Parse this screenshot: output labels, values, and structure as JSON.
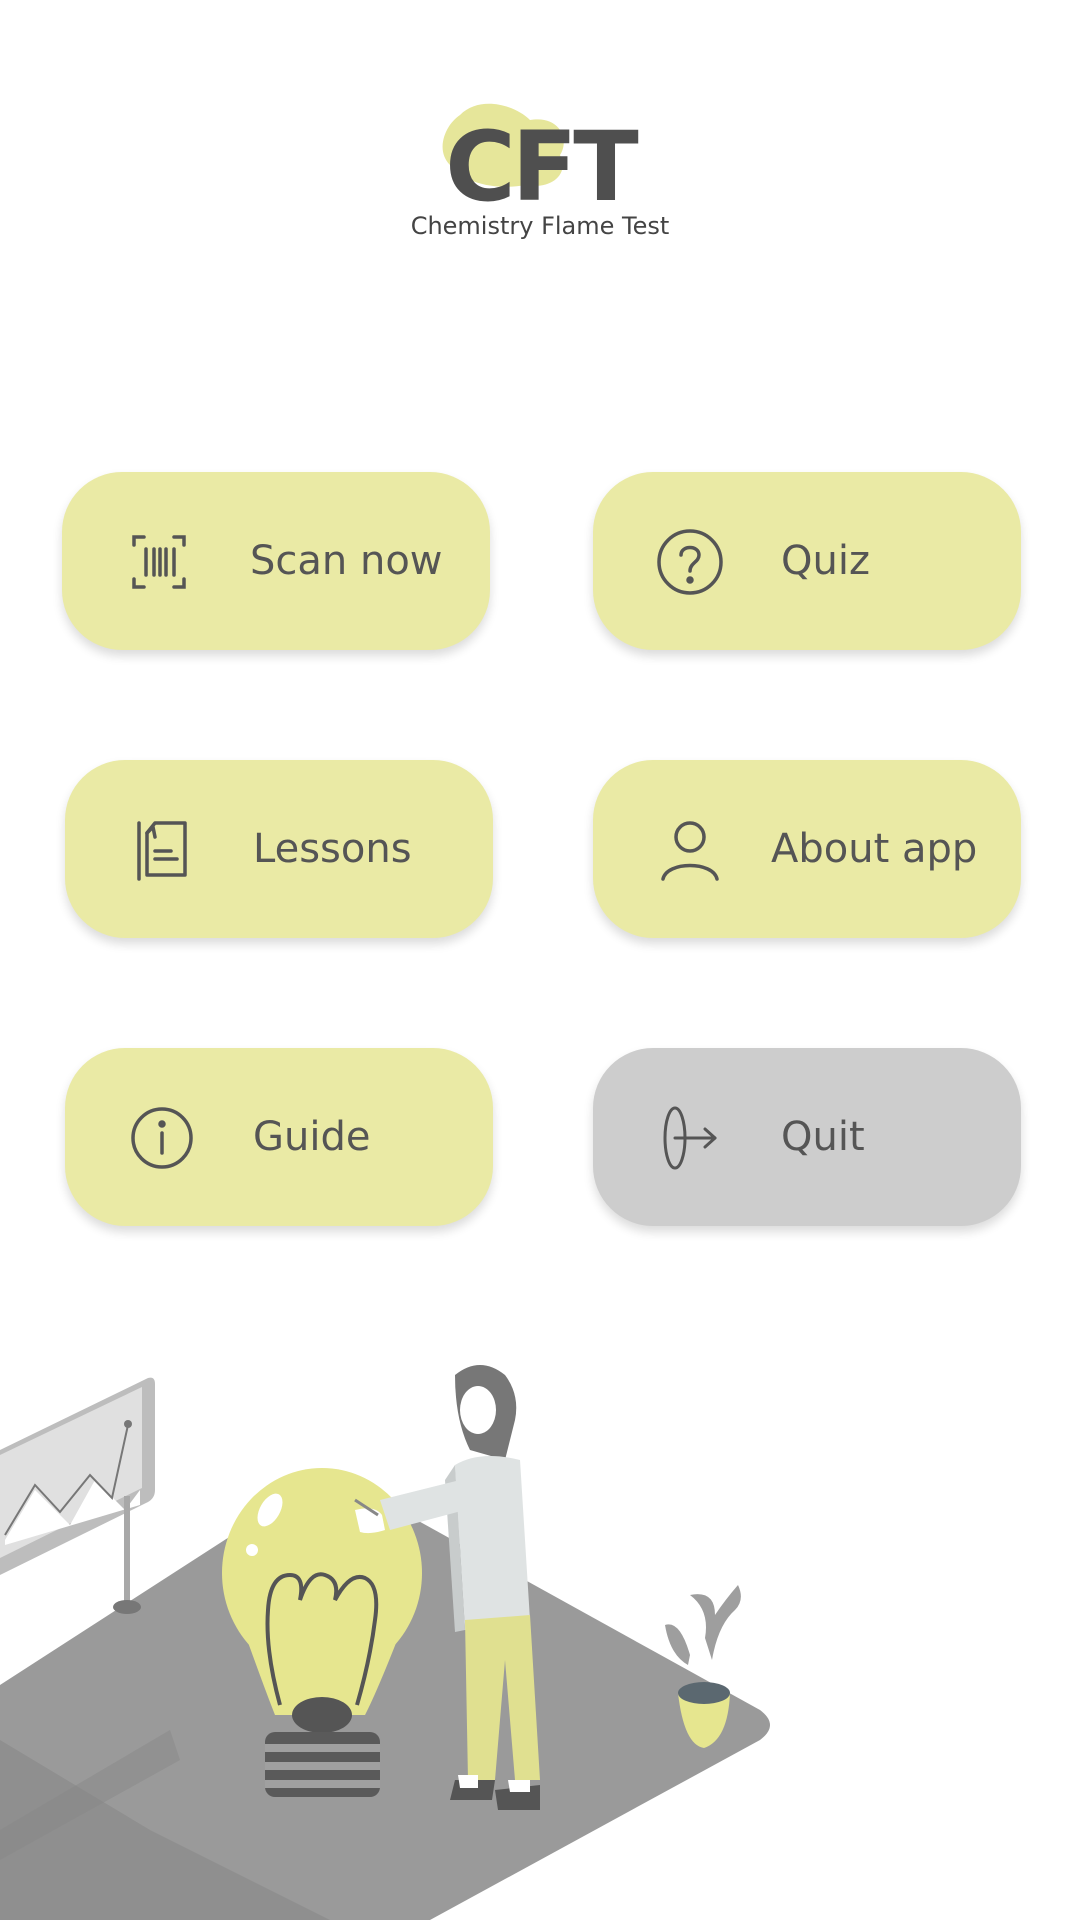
{
  "app": {
    "logo_text": "CFT",
    "subtitle": "Chemistry Flame Test"
  },
  "menu": {
    "scan": {
      "label": "Scan now",
      "icon": "barcode-scan-icon"
    },
    "quiz": {
      "label": "Quiz",
      "icon": "question-circle-icon"
    },
    "lessons": {
      "label": "Lessons",
      "icon": "document-icon"
    },
    "about": {
      "label": "About app",
      "icon": "user-icon"
    },
    "guide": {
      "label": "Guide",
      "icon": "info-circle-icon"
    },
    "quit": {
      "label": "Quit",
      "icon": "exit-arrow-icon"
    }
  },
  "colors": {
    "accent": "#eaeaa5",
    "quit": "#cdcdcd",
    "text": "#555555",
    "logo_blob": "#e6e69a"
  }
}
